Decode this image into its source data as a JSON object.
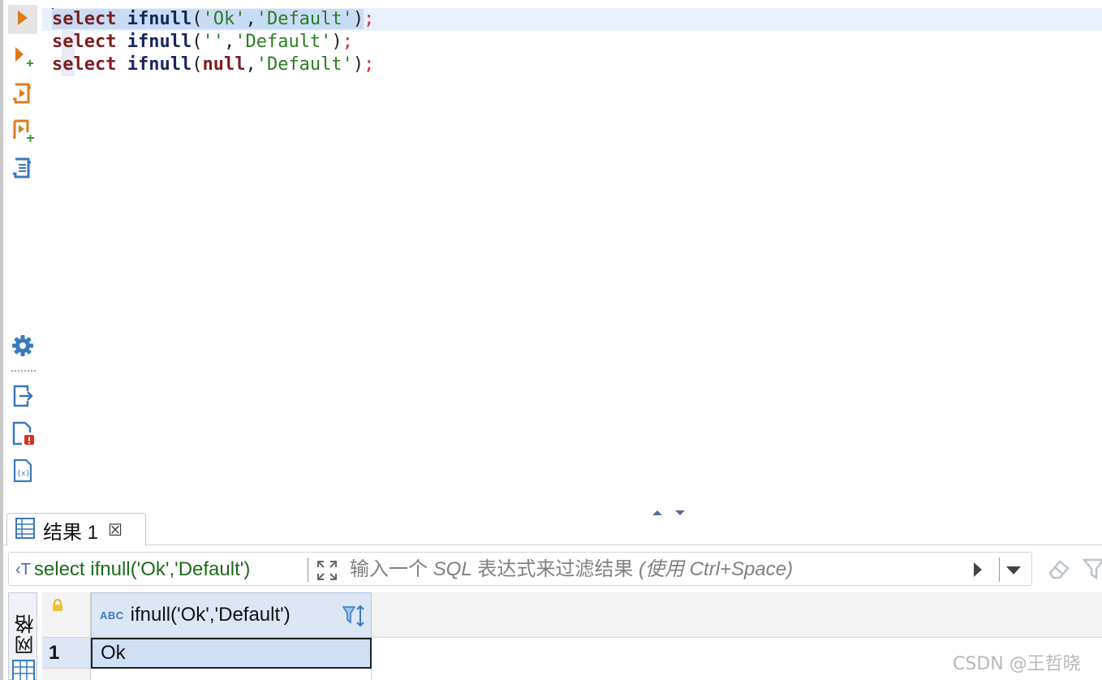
{
  "toolbar": {
    "icons": [
      "execute-statement-icon",
      "execute-in-new-tab-icon",
      "execute-script-icon",
      "execute-script-new-tab-icon",
      "explain-plan-icon",
      "settings-icon",
      "export-icon",
      "problems-icon",
      "variables-icon"
    ]
  },
  "editor": {
    "lines": [
      {
        "kw": "select",
        "fn": "ifnull",
        "open": "(",
        "arg1": "'Ok'",
        "comma": ",",
        "arg2": "'Default'",
        "close": ")",
        "semi": ";"
      },
      {
        "kw": "select",
        "fn": "ifnull",
        "open": "(",
        "arg1": "''",
        "comma": ",",
        "arg2": "'Default'",
        "close": ")",
        "semi": ";"
      },
      {
        "kw": "select",
        "fn": "ifnull",
        "open": "(",
        "arg1": "null",
        "comma": ",",
        "arg2": "'Default'",
        "close": ")",
        "semi": ";"
      }
    ]
  },
  "results": {
    "tab_label": "结果 1",
    "tab_close": "☒",
    "filter": {
      "query": "select ifnull('Ok','Default')",
      "placeholder_pre": "输入一个 ",
      "placeholder_sql": "SQL",
      "placeholder_mid": " 表达式来过滤结果 ",
      "placeholder_hint": "(使用 Ctrl+Space)"
    },
    "side_tab_label": "网格",
    "grid": {
      "columns": [
        {
          "type_badge": "ABC",
          "name": "ifnull('Ok','Default')"
        }
      ],
      "rows": [
        {
          "num": "1",
          "values": [
            "Ok"
          ]
        }
      ]
    }
  },
  "watermark": "CSDN @王哲晓",
  "colors": {
    "keyword": "#7a1f1f",
    "function": "#16275e",
    "string": "#2a7d22",
    "semicolon": "#d22b2b",
    "toolbar_orange": "#e07b1a",
    "toolbar_blue": "#3a78c0",
    "selected_cell": "#cfdff5"
  }
}
